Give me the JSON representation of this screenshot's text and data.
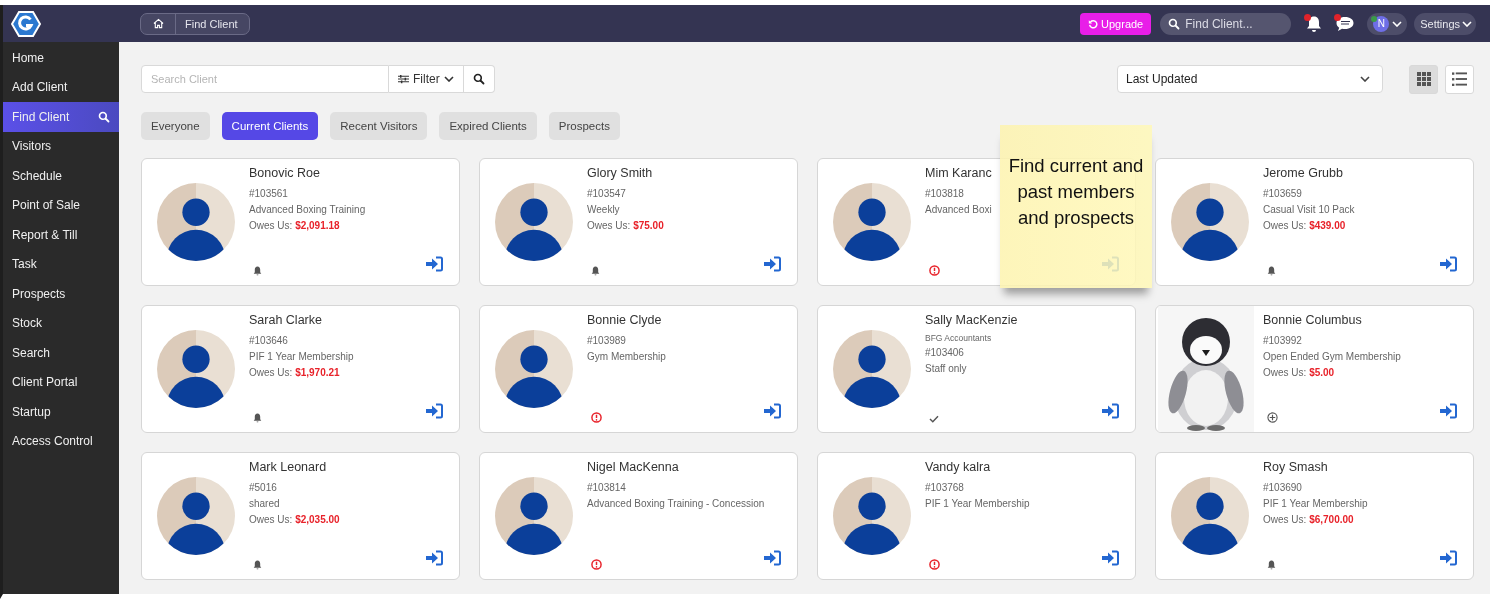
{
  "header": {
    "breadcrumb": "Find Client",
    "upgrade": "Upgrade",
    "search_placeholder": "Find Client...",
    "notifications_unread": true,
    "messages_unread": true,
    "user": {
      "initial": "N",
      "online": true
    },
    "settings": "Settings"
  },
  "sidebar": {
    "items": [
      {
        "label": "Home",
        "selected": false
      },
      {
        "label": "Add Client",
        "selected": false
      },
      {
        "label": "Find Client",
        "selected": true
      },
      {
        "label": "Visitors",
        "selected": false
      },
      {
        "label": "Schedule",
        "selected": false
      },
      {
        "label": "Point of Sale",
        "selected": false
      },
      {
        "label": "Report & Till",
        "selected": false
      },
      {
        "label": "Task",
        "selected": false
      },
      {
        "label": "Prospects",
        "selected": false
      },
      {
        "label": "Stock",
        "selected": false
      },
      {
        "label": "Search",
        "selected": false
      },
      {
        "label": "Client Portal",
        "selected": false
      },
      {
        "label": "Startup",
        "selected": false
      },
      {
        "label": "Access Control",
        "selected": false
      }
    ]
  },
  "toolbar": {
    "search_placeholder": "Search Client",
    "filter": "Filter",
    "sort": "Last Updated",
    "view_buttons": [
      {
        "kind": "grid",
        "selected": true
      },
      {
        "kind": "list",
        "selected": false
      }
    ]
  },
  "filters": [
    {
      "label": "Everyone",
      "selected": false
    },
    {
      "label": "Current Clients",
      "selected": true
    },
    {
      "label": "Recent Visitors",
      "selected": false
    },
    {
      "label": "Expired Clients",
      "selected": false
    },
    {
      "label": "Prospects",
      "selected": false
    }
  ],
  "clients": [
    {
      "name": "Bonovic Roe",
      "number": "#103561",
      "plan": "Advanced Boxing Training",
      "owes": "Owes Us: **$2,091.18**",
      "avatar": {
        "kind": "silhouette"
      },
      "status": {
        "kind": "bell"
      }
    },
    {
      "name": "Glory Smith",
      "number": "#103547",
      "plan": "Weekly",
      "owes": "Owes Us: **$75.00**",
      "avatar": {
        "kind": "silhouette"
      },
      "status": {
        "kind": "bell"
      }
    },
    {
      "name": "Mim Karanc",
      "number": "#103818",
      "plan": "Advanced Boxi",
      "avatar": {
        "kind": "silhouette"
      },
      "status": {
        "kind": "alert"
      }
    },
    {
      "name": "Jerome Grubb",
      "number": "#103659",
      "plan": "Casual Visit 10 Pack",
      "owes": "Owes Us: **$439.00**",
      "avatar": {
        "kind": "silhouette"
      },
      "status": {
        "kind": "bell"
      }
    },
    {
      "name": "Sarah Clarke",
      "number": "#103646",
      "plan": "PIF 1 Year Membership",
      "owes": "Owes Us: **$1,970.21**",
      "avatar": {
        "kind": "silhouette"
      },
      "status": {
        "kind": "bell"
      }
    },
    {
      "name": "Bonnie Clyde",
      "number": "#103989",
      "plan": "Gym Membership",
      "avatar": {
        "kind": "silhouette"
      },
      "status": {
        "kind": "alert"
      }
    },
    {
      "name": "Sally MacKenzie",
      "company": "BFG Accountants",
      "number": "#103406",
      "plan": "Staff only",
      "avatar": {
        "kind": "silhouette"
      },
      "status": {
        "kind": "check"
      }
    },
    {
      "name": "Bonnie Columbus",
      "number": "#103992",
      "plan": "Open Ended Gym Membership",
      "owes": "Owes Us: **$5.00**",
      "status": {
        "kind": "plus"
      }
    },
    {
      "name": "Mark Leonard",
      "number": "#5016",
      "plan": "shared",
      "owes": "Owes Us: **$2,035.00**",
      "avatar": {
        "kind": "silhouette"
      },
      "status": {
        "kind": "bell"
      }
    },
    {
      "name": "Nigel MacKenna",
      "number": "#103814",
      "plan": "Advanced Boxing Training - Concession",
      "avatar": {
        "kind": "silhouette"
      },
      "status": {
        "kind": "alert"
      }
    },
    {
      "name": "Vandy kalra",
      "number": "#103768",
      "plan": "PIF 1 Year Membership",
      "avatar": {
        "kind": "silhouette"
      },
      "status": {
        "kind": "alert"
      }
    },
    {
      "name": "Roy Smash",
      "number": "#103690",
      "plan": "PIF 1 Year Membership",
      "owes": "Owes Us: **$6,700.00**",
      "avatar": {
        "kind": "silhouette"
      },
      "status": {
        "kind": "bell"
      }
    }
  ],
  "sticky_note": {
    "text": "Find current and past members and prospects"
  }
}
